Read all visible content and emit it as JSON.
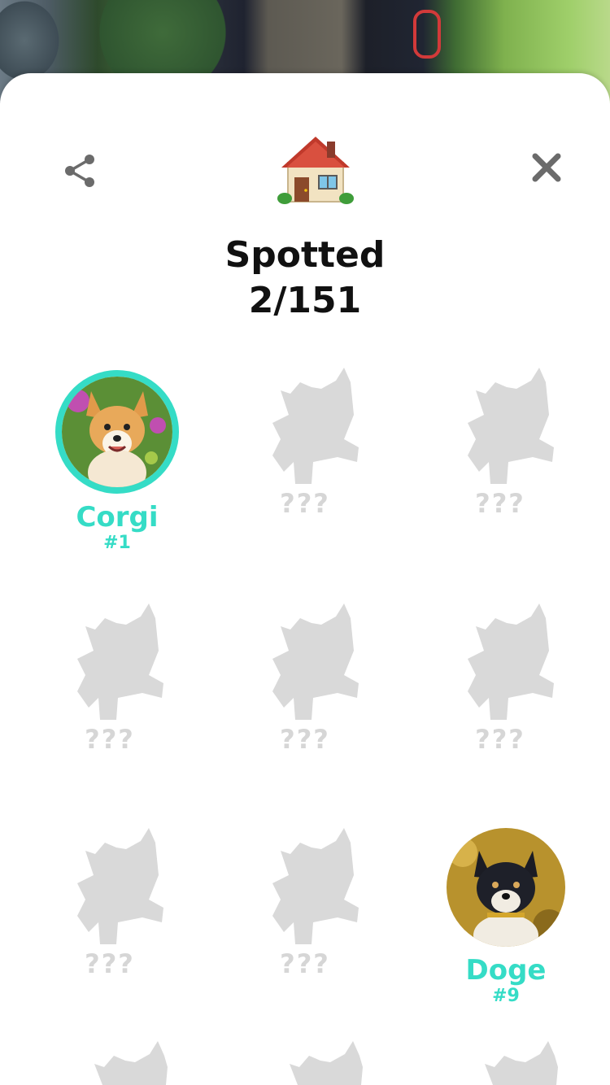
{
  "header": {
    "title_line1": "Spotted",
    "title_line2": "2/151",
    "share_icon": "share-icon",
    "close_icon": "close-icon",
    "home_icon": "house-emoji"
  },
  "colors": {
    "accent": "#35dcc6",
    "locked": "#d6d6d6",
    "title": "#111111"
  },
  "dogs": [
    {
      "name": "Corgi",
      "number": "#1",
      "spotted": true
    },
    {
      "name": "???",
      "spotted": false
    },
    {
      "name": "???",
      "spotted": false
    },
    {
      "name": "???",
      "spotted": false
    },
    {
      "name": "???",
      "spotted": false
    },
    {
      "name": "???",
      "spotted": false
    },
    {
      "name": "???",
      "spotted": false
    },
    {
      "name": "???",
      "spotted": false
    },
    {
      "name": "Doge",
      "number": "#9",
      "spotted": true
    }
  ]
}
